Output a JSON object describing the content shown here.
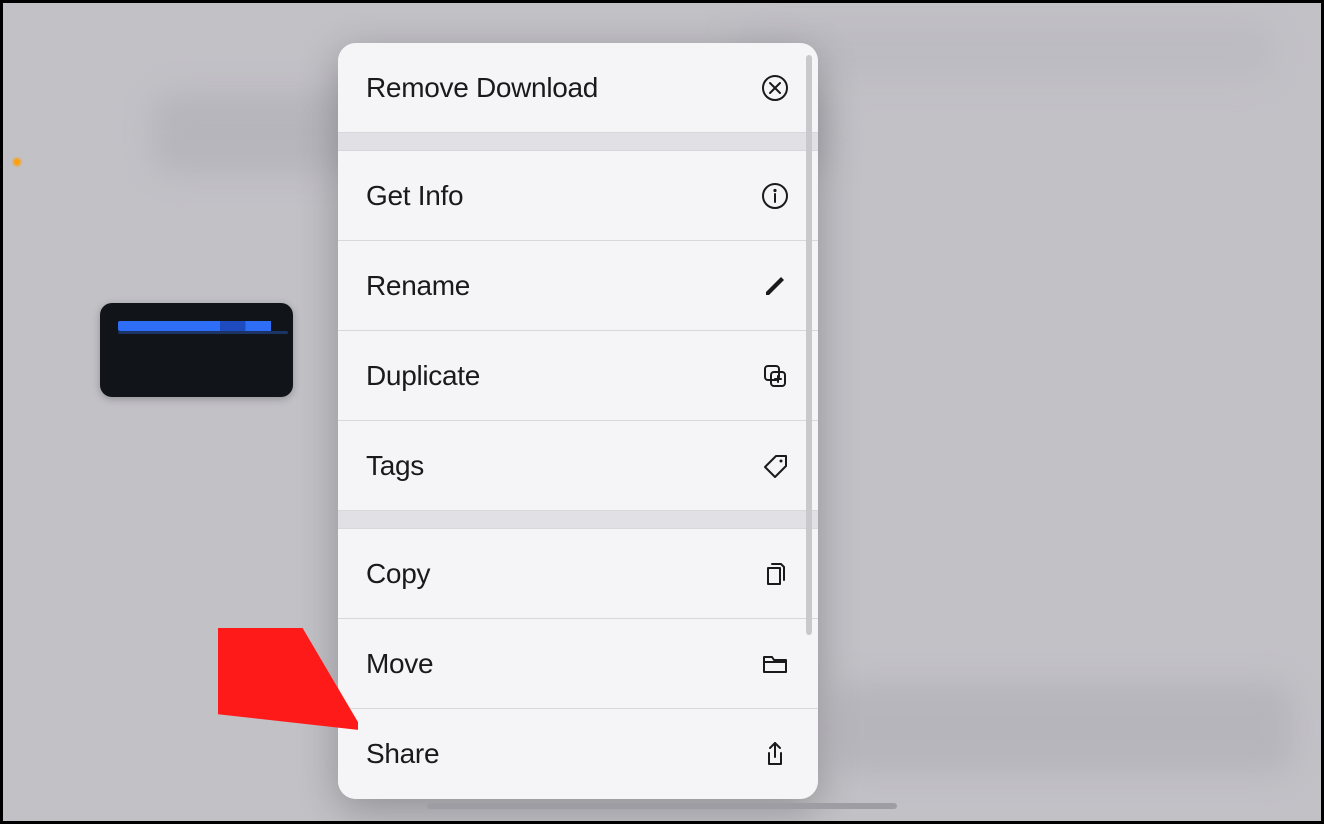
{
  "menu": {
    "remove_download": "Remove Download",
    "get_info": "Get Info",
    "rename": "Rename",
    "duplicate": "Duplicate",
    "tags": "Tags",
    "copy": "Copy",
    "move": "Move",
    "share": "Share"
  }
}
